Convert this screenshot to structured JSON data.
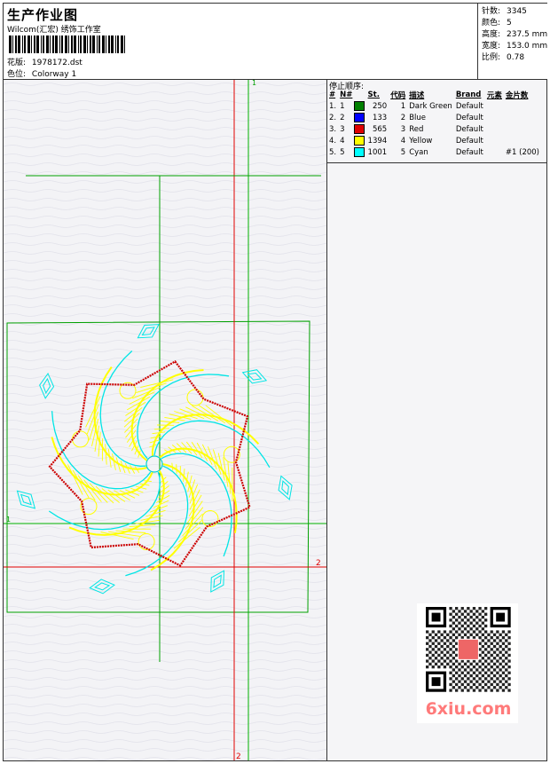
{
  "header": {
    "title": "生产作业图",
    "company": "Wilcom(汇宏) 绣饰工作室",
    "design_label": "花版:",
    "design_value": "1978172.dst",
    "colorway_label": "色位:",
    "colorway_value": "Colorway 1"
  },
  "stats": [
    {
      "label": "针数:",
      "value": "3345"
    },
    {
      "label": "颜色:",
      "value": "5"
    },
    {
      "label": "高度:",
      "value": "237.5 mm"
    },
    {
      "label": "宽度:",
      "value": "153.0 mm"
    },
    {
      "label": "比例:",
      "value": "0.78"
    }
  ],
  "guides": {
    "mark_1_top": "1",
    "mark_1_left": "1",
    "mark_2_right": "2",
    "mark_2_bottom": "2"
  },
  "stop_sequence": {
    "title": "停止顺序:",
    "headers": [
      "#",
      "N#",
      "St.",
      "代码",
      "描述",
      "Brand",
      "元素",
      "金片数"
    ],
    "rows": [
      {
        "n": "1.",
        "nn": "1",
        "st": "250",
        "code": "1",
        "desc": "Dark Green",
        "brand": "Default",
        "elem": "",
        "seq": "",
        "color": "#008000"
      },
      {
        "n": "2.",
        "nn": "2",
        "st": "133",
        "code": "2",
        "desc": "Blue",
        "brand": "Default",
        "elem": "",
        "seq": "",
        "color": "#0000ff"
      },
      {
        "n": "3.",
        "nn": "3",
        "st": "565",
        "code": "3",
        "desc": "Red",
        "brand": "Default",
        "elem": "",
        "seq": "",
        "color": "#e00000"
      },
      {
        "n": "4.",
        "nn": "4",
        "st": "1394",
        "code": "4",
        "desc": "Yellow",
        "brand": "Default",
        "elem": "",
        "seq": "",
        "color": "#ffff00"
      },
      {
        "n": "5.",
        "nn": "5",
        "st": "1001",
        "code": "5",
        "desc": "Cyan",
        "brand": "Default",
        "elem": "",
        "seq": "#1 (200)",
        "color": "#00ffff"
      }
    ]
  },
  "watermark": "6xiu.com",
  "colors": {
    "guide_green": "#00b000",
    "guide_red": "#e00000",
    "thread_yellow": "#ffff00",
    "thread_cyan": "#00e5e5",
    "thread_red": "#cc0000"
  }
}
